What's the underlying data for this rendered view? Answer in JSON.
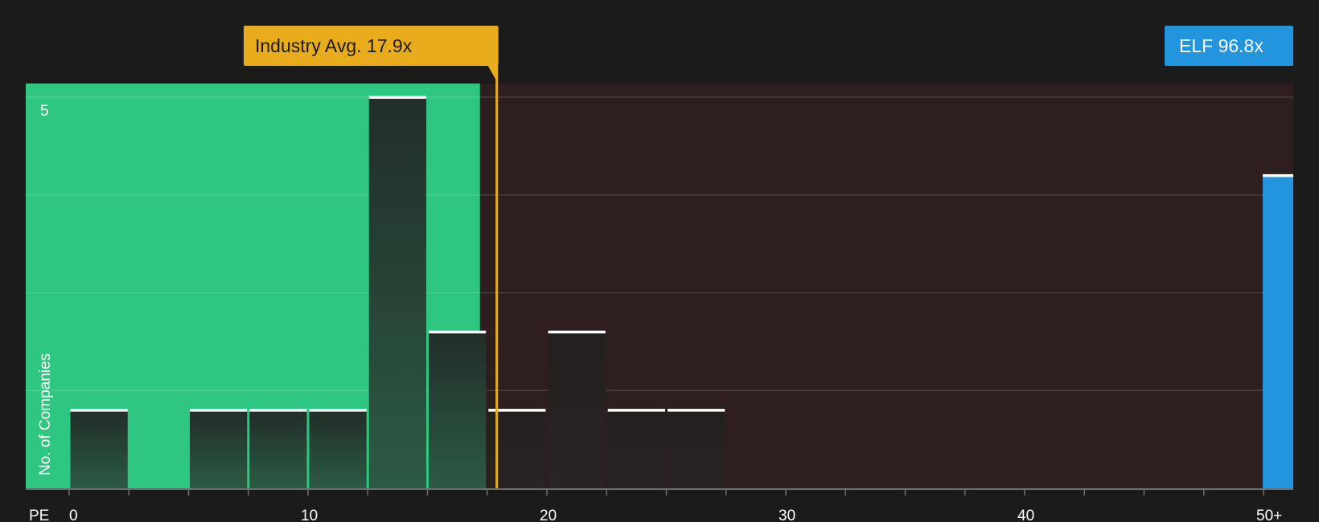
{
  "chart_data": {
    "type": "bar",
    "xlabel": "PE",
    "ylabel": "No. of Companies",
    "x_ticks": [
      "0",
      "10",
      "20",
      "30",
      "40",
      "50+"
    ],
    "y_ticks": [
      "5"
    ],
    "ylim": [
      0,
      5.15
    ],
    "bin_width": 2.5,
    "bins": [
      {
        "start": 0,
        "count": 1
      },
      {
        "start": 2.5,
        "count": 0
      },
      {
        "start": 5,
        "count": 1
      },
      {
        "start": 7.5,
        "count": 1
      },
      {
        "start": 10,
        "count": 1
      },
      {
        "start": 12.5,
        "count": 5
      },
      {
        "start": 15,
        "count": 2
      },
      {
        "start": 17.5,
        "count": 1
      },
      {
        "start": 20,
        "count": 2
      },
      {
        "start": 22.5,
        "count": 1
      },
      {
        "start": 25,
        "count": 1
      }
    ],
    "below_average_max": 17.2,
    "industry_average": {
      "label": "Industry Avg. 17.9x",
      "value": 17.9
    },
    "company": {
      "label": "ELF 96.8x",
      "value": 96.8,
      "bar_count": 4
    },
    "colors": {
      "background": "#1b1b1b",
      "below_avg_region": "#2ec680",
      "above_avg_region": "#2f1e1f",
      "bar_fill": "#243b32",
      "bar_cap": "#ffffff",
      "avg_line": "#e8ac1c",
      "company_bar": "#2394de"
    }
  }
}
